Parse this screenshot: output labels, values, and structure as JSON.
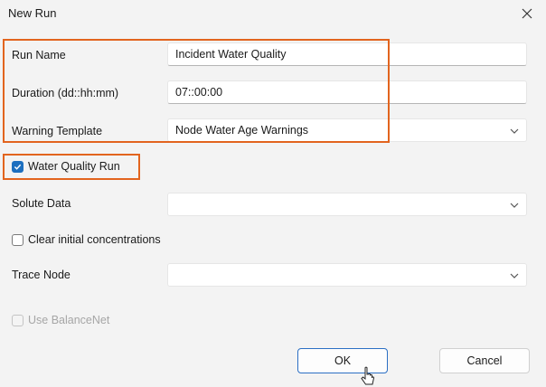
{
  "dialog": {
    "title": "New Run"
  },
  "fields": {
    "run_name": {
      "label": "Run Name",
      "value": "Incident Water Quality"
    },
    "duration": {
      "label": "Duration (dd::hh:mm)",
      "value": "07::00:00"
    },
    "warning_template": {
      "label": "Warning Template",
      "value": "Node Water Age Warnings"
    },
    "water_quality_run": {
      "label": "Water Quality Run",
      "checked": true
    },
    "solute_data": {
      "label": "Solute Data",
      "value": ""
    },
    "clear_initial": {
      "label": "Clear initial concentrations",
      "checked": false
    },
    "trace_node": {
      "label": "Trace Node",
      "value": ""
    },
    "use_balancenet": {
      "label": "Use BalanceNet",
      "checked": false,
      "disabled": true
    }
  },
  "buttons": {
    "ok": "OK",
    "cancel": "Cancel"
  },
  "colors": {
    "highlight": "#e2641e",
    "accent": "#1d6fbf"
  }
}
